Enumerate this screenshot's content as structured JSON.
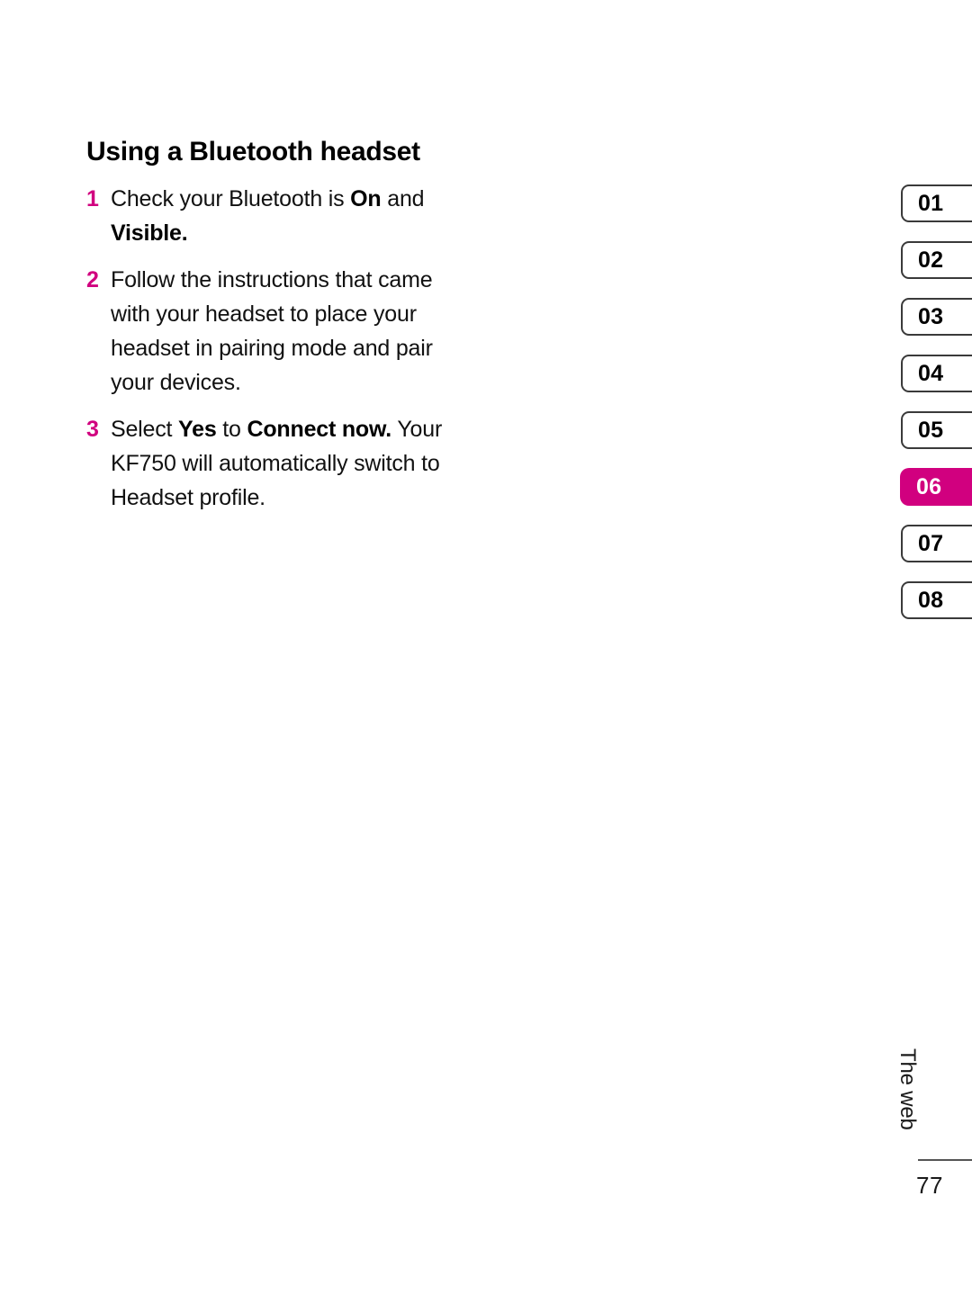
{
  "page": {
    "heading": "Using a Bluetooth headset",
    "steps": [
      {
        "number": "1",
        "parts": [
          {
            "text": "Check your Bluetooth is ",
            "bold": false
          },
          {
            "text": "On",
            "bold": true
          },
          {
            "text": " and ",
            "bold": false
          },
          {
            "text": "Visible.",
            "bold": true
          }
        ]
      },
      {
        "number": "2",
        "parts": [
          {
            "text": "Follow the instructions that came with your headset to place your headset in pairing mode and pair your devices.",
            "bold": false
          }
        ]
      },
      {
        "number": "3",
        "parts": [
          {
            "text": "Select ",
            "bold": false
          },
          {
            "text": "Yes",
            "bold": true
          },
          {
            "text": " to ",
            "bold": false
          },
          {
            "text": "Connect now.",
            "bold": true
          },
          {
            "text": " Your KF750 will automatically switch to Headset profile.",
            "bold": false
          }
        ]
      }
    ]
  },
  "tabs": {
    "items": [
      {
        "label": "01",
        "active": false
      },
      {
        "label": "02",
        "active": false
      },
      {
        "label": "03",
        "active": false
      },
      {
        "label": "04",
        "active": false
      },
      {
        "label": "05",
        "active": false
      },
      {
        "label": "06",
        "active": true
      },
      {
        "label": "07",
        "active": false
      },
      {
        "label": "08",
        "active": false
      }
    ]
  },
  "footer": {
    "section_label": "The web",
    "page_number": "77"
  },
  "colors": {
    "accent_magenta": "#d1007f",
    "text": "#111111",
    "tab_border": "#3a3a3a",
    "rule": "#555555",
    "background": "#ffffff"
  }
}
